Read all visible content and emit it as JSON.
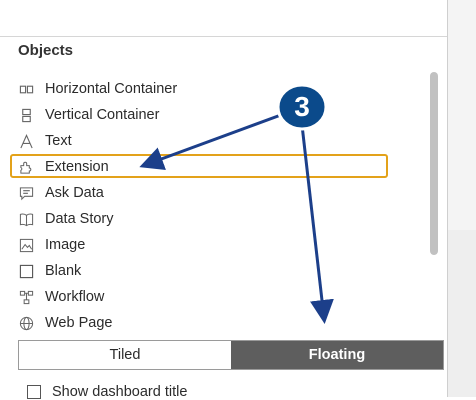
{
  "panel": {
    "title": "Objects",
    "items": [
      {
        "label": "Horizontal Container",
        "icon": "horizontal-container-icon"
      },
      {
        "label": "Vertical Container",
        "icon": "vertical-container-icon"
      },
      {
        "label": "Text",
        "icon": "text-icon"
      },
      {
        "label": "Extension",
        "icon": "extension-icon",
        "highlighted": true
      },
      {
        "label": "Ask Data",
        "icon": "ask-data-icon"
      },
      {
        "label": "Data Story",
        "icon": "data-story-icon"
      },
      {
        "label": "Image",
        "icon": "image-icon"
      },
      {
        "label": "Blank",
        "icon": "blank-icon"
      },
      {
        "label": "Workflow",
        "icon": "workflow-icon"
      },
      {
        "label": "Web Page",
        "icon": "web-page-icon"
      }
    ]
  },
  "layout_toggle": {
    "tiled_label": "Tiled",
    "floating_label": "Floating",
    "selected": "Floating"
  },
  "show_title": {
    "label": "Show dashboard title",
    "checked": false
  },
  "annotation": {
    "step_number": "3",
    "badge_color": "#0b4a8b",
    "arrow_color": "#1c3f8a",
    "highlight_color": "#e3a21a"
  }
}
